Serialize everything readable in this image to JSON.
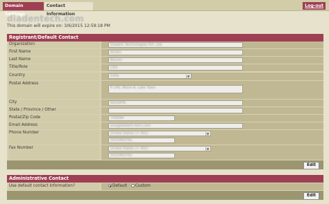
{
  "tabs": {
    "domain_settings": "Domain Settings",
    "contact_information": "Contact Information"
  },
  "logout": "Log-out",
  "brand": "diadentech.com",
  "expiry_text": "This domain will expire on: 3/6/2015 12:59:18 PM",
  "registrant": {
    "title": "Registrant/Default Contact",
    "organization_label": "Organization",
    "organization_value": "Diadem Technologies Pvt. Ltd.",
    "first_name_label": "First Name",
    "first_name_value": "Anshu",
    "last_name_label": "Last Name",
    "last_name_value": "Bocani",
    "title_role_label": "Title/Role",
    "title_role_value": "CEO",
    "country_label": "Country",
    "country_value": "India",
    "postal_address_label": "Postal Address",
    "postal_address_value": "P-245, Block-A, Lake Town",
    "city_label": "City",
    "city_value": "KOLKATA",
    "state_label": "State / Province / Other",
    "state_value": "",
    "postal_code_label": "Postal/Zip Code",
    "postal_code_value": "700089",
    "email_label": "Email Address",
    "email_value": "ana@diadem-tech.com",
    "phone_label": "Phone Number",
    "phone_country": "United States (+ 001)",
    "phone_value": "3323493761",
    "fax_label": "Fax Number",
    "fax_country": "United States (+ 001)",
    "fax_value": "3323493761",
    "edit_label": "Edit"
  },
  "administrative": {
    "title": "Administrative Contact",
    "default_question": "Use default contact information?",
    "default_option": "Default",
    "custom_option": "Custom",
    "default_selected": true,
    "edit_label": "Edit"
  }
}
